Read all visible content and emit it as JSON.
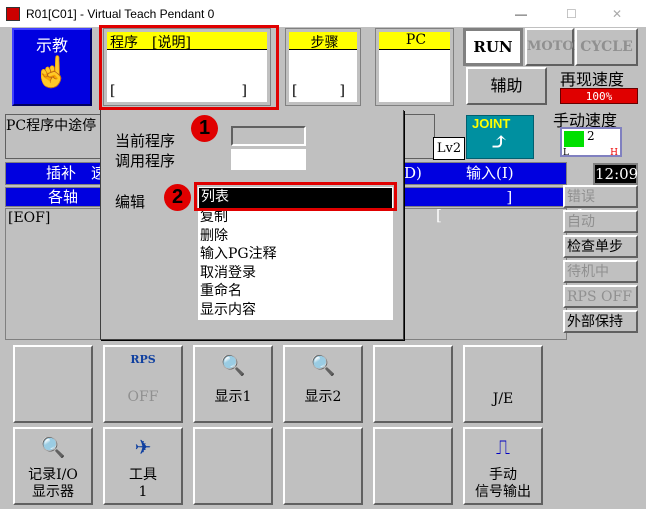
{
  "window": {
    "title": "R01[C01] - Virtual Teach Pendant 0",
    "minimize": "—",
    "maximize": "☐",
    "close": "✕"
  },
  "mode": {
    "label": "示教",
    "icon": "hand-pointer-icon"
  },
  "program_box": {
    "header": "程序　[说明]",
    "value": "[　　　　　　　　　]"
  },
  "step_box": {
    "header": "步骤",
    "value": "[　　　]"
  },
  "pc_box": {
    "header": "PC",
    "value": ""
  },
  "status": {
    "run": "RUN",
    "motor": "MOTOR",
    "cycle": "CYCLE"
  },
  "aux_button": "辅助",
  "replay_speed": {
    "label": "再现速度",
    "value": "100%"
  },
  "manual_speed": {
    "label": "手动速度",
    "level": "2",
    "low": "L",
    "high": "H"
  },
  "pc_stop_text": "PC程序中途停",
  "level": "Lv2",
  "joint": "JOINT",
  "bar1": {
    "left": "插补　速",
    "right_partial": "D)",
    "input": "输入(I)"
  },
  "bar2": {
    "left": "各轴",
    "brackets": "][　　　　　　　　　]"
  },
  "clock": "12:09",
  "eof": "[EOF]",
  "right_buttons": [
    {
      "label": "错误",
      "enabled": false
    },
    {
      "label": "自动",
      "enabled": false
    },
    {
      "label": "检查单步",
      "enabled": true
    },
    {
      "label": "待机中",
      "enabled": false
    },
    {
      "label": "RPS OFF",
      "enabled": false
    },
    {
      "label": "外部保持",
      "enabled": true
    }
  ],
  "popup": {
    "current_program_label": "当前程序",
    "call_program_label": "调用程序",
    "edit_label": "编辑",
    "badge1": "1",
    "badge2": "2",
    "menu_items": [
      "列表",
      "复制",
      "删除",
      "输入PG注释",
      "取消登录",
      "重命名",
      "显示内容"
    ],
    "selected_index": 0
  },
  "bottom_row1": [
    {
      "label": "",
      "icon": ""
    },
    {
      "label": "OFF",
      "icon": "rps-icon",
      "sub": "RPS",
      "enabled": false
    },
    {
      "label": "显示1",
      "icon": "display-magnifier-icon"
    },
    {
      "label": "显示2",
      "icon": "display-magnifier-icon"
    },
    {
      "label": "",
      "icon": ""
    },
    {
      "label": "J/E",
      "icon": ""
    }
  ],
  "bottom_row2": [
    {
      "label": "记录I/O\n显示器",
      "icon": "io-monitor-icon"
    },
    {
      "label": "工具\n1",
      "icon": "tool-icon"
    },
    {
      "label": "",
      "icon": ""
    },
    {
      "label": "",
      "icon": ""
    },
    {
      "label": "",
      "icon": ""
    },
    {
      "label": "手动\n信号输出",
      "icon": "signal-pulse-icon"
    }
  ],
  "colors": {
    "mode_blue": "#0000e0",
    "header_yellow": "#ffff00",
    "highlight_red": "#e00000",
    "joint_teal": "#0090a0",
    "speed_green": "#00e000"
  }
}
